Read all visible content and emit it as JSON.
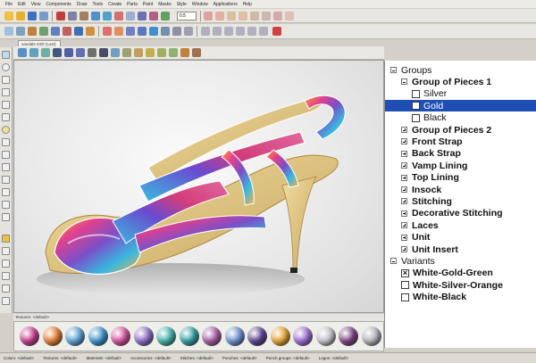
{
  "menu": [
    "File",
    "Edit",
    "View",
    "Components",
    "Draw",
    "Tools",
    "Create",
    "Parts",
    "Paint",
    "Masks",
    "Style",
    "Window",
    "Applications",
    "Help"
  ],
  "toolbar": {
    "zoom_value": "0.5"
  },
  "document_tab": "sandals-S3D (Last)",
  "tree": {
    "rows": [
      {
        "label": "Groups",
        "indent": 0,
        "expander": "minus",
        "checkbox": null,
        "bold": false,
        "selected": false
      },
      {
        "label": "Group of Pieces 1",
        "indent": 1,
        "expander": "minus",
        "checkbox": null,
        "bold": true,
        "selected": false
      },
      {
        "label": "Silver",
        "indent": 2,
        "expander": null,
        "checkbox": "unchecked",
        "bold": false,
        "selected": false
      },
      {
        "label": "Gold",
        "indent": 2,
        "expander": null,
        "checkbox": "unchecked",
        "bold": false,
        "selected": true
      },
      {
        "label": "Black",
        "indent": 2,
        "expander": null,
        "checkbox": "unchecked",
        "bold": false,
        "selected": false
      },
      {
        "label": "Group of Pieces 2",
        "indent": 1,
        "expander": "plus",
        "checkbox": null,
        "bold": true,
        "selected": false
      },
      {
        "label": "Front Strap",
        "indent": 1,
        "expander": "plus",
        "checkbox": null,
        "bold": true,
        "selected": false
      },
      {
        "label": "Back Strap",
        "indent": 1,
        "expander": "plus",
        "checkbox": null,
        "bold": true,
        "selected": false
      },
      {
        "label": "Vamp Lining",
        "indent": 1,
        "expander": "plus",
        "checkbox": null,
        "bold": true,
        "selected": false
      },
      {
        "label": "Top Lining",
        "indent": 1,
        "expander": "plus",
        "checkbox": null,
        "bold": true,
        "selected": false
      },
      {
        "label": "Insock",
        "indent": 1,
        "expander": "plus",
        "checkbox": null,
        "bold": true,
        "selected": false
      },
      {
        "label": "Stitching",
        "indent": 1,
        "expander": "plus",
        "checkbox": null,
        "bold": true,
        "selected": false
      },
      {
        "label": "Decorative Stitching",
        "indent": 1,
        "expander": "plus",
        "checkbox": null,
        "bold": true,
        "selected": false
      },
      {
        "label": "Laces",
        "indent": 1,
        "expander": "plus",
        "checkbox": null,
        "bold": true,
        "selected": false
      },
      {
        "label": "Unit",
        "indent": 1,
        "expander": "plus",
        "checkbox": null,
        "bold": true,
        "selected": false
      },
      {
        "label": "Unit Insert",
        "indent": 1,
        "expander": "plus",
        "checkbox": null,
        "bold": true,
        "selected": false
      },
      {
        "label": "Variants",
        "indent": 0,
        "expander": "minus",
        "checkbox": null,
        "bold": false,
        "selected": false
      },
      {
        "label": "White-Gold-Green",
        "indent": 1,
        "expander": null,
        "checkbox": "checked",
        "bold": true,
        "selected": false
      },
      {
        "label": "White-Silver-Orange",
        "indent": 1,
        "expander": null,
        "checkbox": "unchecked",
        "bold": true,
        "selected": false
      },
      {
        "label": "White-Black",
        "indent": 1,
        "expander": null,
        "checkbox": "unchecked",
        "bold": true,
        "selected": false
      }
    ]
  },
  "textures": {
    "label": "Textures: <default>",
    "swatches": [
      "#c23a8c",
      "#e07a30",
      "#5aa0d6",
      "#3b8fc8",
      "#d04f9a",
      "#8a6ac0",
      "#3fb0a8",
      "#2f9a9e",
      "#a05a9e",
      "#6a8fd0",
      "#5a3f8e",
      "#e0a030",
      "#9a6ad0",
      "#c0c0c8",
      "#7a3f7e",
      "#b0b0b8"
    ]
  },
  "status": [
    "Colors: <default>",
    "Textures: <default>",
    "Materials: <default>",
    "Accessories: <default>",
    "Stitches: <default>",
    "Punches: <default>",
    "Punch groups: <default>",
    "Logos: <default>"
  ]
}
